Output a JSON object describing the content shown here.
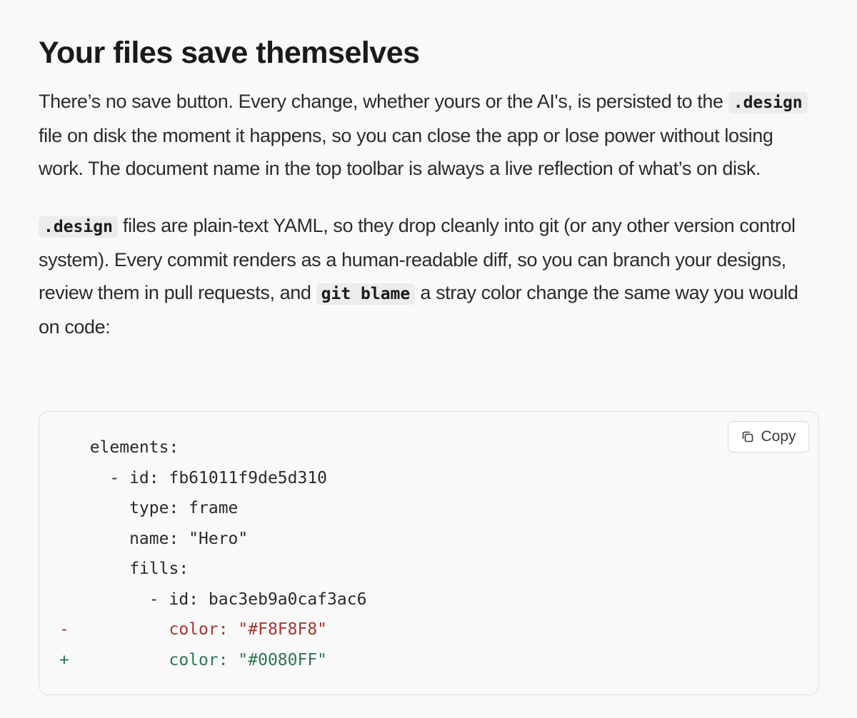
{
  "heading": "Your files save themselves",
  "paragraph1": {
    "part1": "There’s no save button. Every change, whether yours or the AI's, is persisted to the",
    "code1": ".design",
    "part2": "file on disk the moment it happens, so you can close the app or lose power without losing work. The document name in the top toolbar is always a live reflection of what’s on disk."
  },
  "paragraph2": {
    "code1": ".design",
    "part1": "files are plain-text YAML, so they drop cleanly into git (or any other version control system). Every commit renders as a human-readable diff, so you can branch your designs, review them in pull requests, and",
    "code2": "git blame",
    "part2": "a stray color change the same way you would on code:"
  },
  "code_block": {
    "copy_label": "Copy",
    "copy_icon": "copy-icon",
    "lines": [
      {
        "marker": "",
        "text": "elements:",
        "kind": "normal"
      },
      {
        "marker": "",
        "text": "  - id: fb61011f9de5d310",
        "kind": "normal"
      },
      {
        "marker": "",
        "text": "    type: frame",
        "kind": "normal"
      },
      {
        "marker": "",
        "text": "    name: \"Hero\"",
        "kind": "normal"
      },
      {
        "marker": "",
        "text": "    fills:",
        "kind": "normal"
      },
      {
        "marker": "",
        "text": "      - id: bac3eb9a0caf3ac6",
        "kind": "normal"
      },
      {
        "marker": "-",
        "text": "        color: \"#F8F8F8\"",
        "kind": "del"
      },
      {
        "marker": "+",
        "text": "        color: \"#0080FF\"",
        "kind": "add"
      }
    ]
  },
  "colors": {
    "background": "#f9f9f9",
    "deletion": "#a3372e",
    "addition": "#2d7552",
    "inline_code_bg": "#ececec"
  }
}
